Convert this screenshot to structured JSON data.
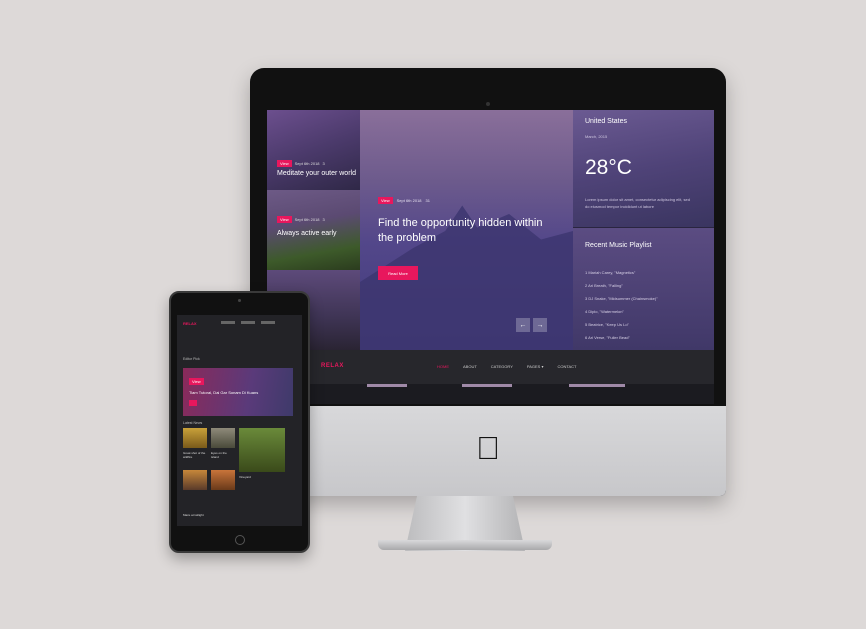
{
  "imac": {
    "site": {
      "tiles": [
        {
          "badge": "View",
          "meta": "Sept 6th 2018",
          "comments": "3",
          "title": "Meditate your outer world"
        },
        {
          "badge": "View",
          "meta": "Sept 6th 2018",
          "comments": "3",
          "title": "Always active early"
        },
        {
          "badge": "",
          "meta": "",
          "comments": "",
          "title": ""
        }
      ],
      "hero": {
        "badge": "View",
        "meta": "Sept 6th 2018",
        "comments": "31",
        "title": "Find the opportunity hidden within the problem",
        "button": "Read More",
        "prev": "←",
        "next": "→"
      },
      "weather": {
        "location": "United States",
        "date": "March, 2015",
        "temperature": "28°C",
        "description": "Lorem ipsum dolor sit amet, consectetur adipiscing elit, sed do eiusmod tempor incididunt ut labore"
      },
      "playlist": {
        "title": "Recent Music Playlist",
        "tracks": [
          "1 Mariah Carey, \"Magnetics\"",
          "2 Ari Breath, \"Falling\"",
          "3 DJ Snake, \"Midsummer (Chainsmoke)\"",
          "4 Diplo, \"Watermelon\"",
          "5 Beatrice, \"Keep Us Lo\"",
          "6 Ari Verse, \"Fuller Bead\""
        ]
      },
      "nav": {
        "logo": "RELAX",
        "menu": [
          "HOME",
          "ABOUT",
          "CATEGORY",
          "PAGES ▾",
          "CONTACT"
        ]
      }
    }
  },
  "ipad": {
    "logo": "RELAX",
    "featured_section": "Editor Pick",
    "featured": {
      "badge": "View",
      "title": "Tiam Tutoral, Dai Gar Sonam Di Kuans"
    },
    "latest_section": "Latest News",
    "captions": [
      "Great shot of the wildfire",
      "Eyes on the island",
      "Vineyard",
      "Maze at twilight"
    ]
  },
  "colors": {
    "accent": "#e8175d",
    "background": "#ddd9d8",
    "screen_dark": "#27272c"
  },
  "icons": [
    "apple-logo-icon",
    "arrow-left-icon",
    "arrow-right-icon",
    "download-icon"
  ]
}
